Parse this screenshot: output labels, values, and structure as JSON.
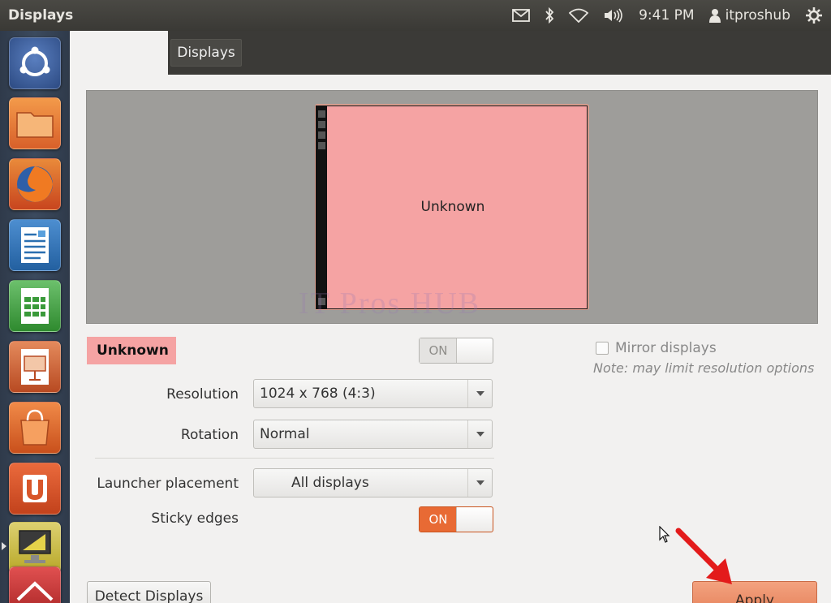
{
  "top_panel": {
    "title": "Displays",
    "time": "9:41 PM",
    "user": "itproshub",
    "icons": [
      "mail-icon",
      "bluetooth-icon",
      "wifi-icon",
      "volume-icon",
      "user-icon",
      "gear-icon"
    ]
  },
  "launcher": {
    "items": [
      {
        "name": "ubuntu-dash-icon",
        "color": "#3b5f9e"
      },
      {
        "name": "files-icon",
        "color": "#e8732e"
      },
      {
        "name": "firefox-icon",
        "color": "#d9541e"
      },
      {
        "name": "writer-icon",
        "color": "#2a6fb0"
      },
      {
        "name": "calc-icon",
        "color": "#3a9a3a"
      },
      {
        "name": "impress-icon",
        "color": "#c4542a"
      },
      {
        "name": "software-center-icon",
        "color": "#e06a28"
      },
      {
        "name": "ubuntu-one-icon",
        "color": "#d8562a"
      },
      {
        "name": "system-settings-icon",
        "color": "#c9c02e"
      },
      {
        "name": "remote-icon",
        "color": "#b82e2e"
      }
    ]
  },
  "window": {
    "tab_label": "Displays",
    "monitor_label": "Unknown",
    "watermark": "IT Pros HUB",
    "display_name": "Unknown",
    "display_toggle": "ON",
    "mirror_label": "Mirror displays",
    "note": "Note: may limit resolution options",
    "resolution_label": "Resolution",
    "resolution_value": "1024 x 768 (4:3)",
    "rotation_label": "Rotation",
    "rotation_value": "Normal",
    "launcher_placement_label": "Launcher placement",
    "launcher_placement_value": "All displays",
    "sticky_edges_label": "Sticky edges",
    "sticky_edges_toggle": "ON",
    "detect_label": "Detect Displays",
    "apply_label": "Apply"
  },
  "colors": {
    "accent": "#e86a34",
    "monitor": "#f5a3a3",
    "arrow": "#e31b1b"
  }
}
